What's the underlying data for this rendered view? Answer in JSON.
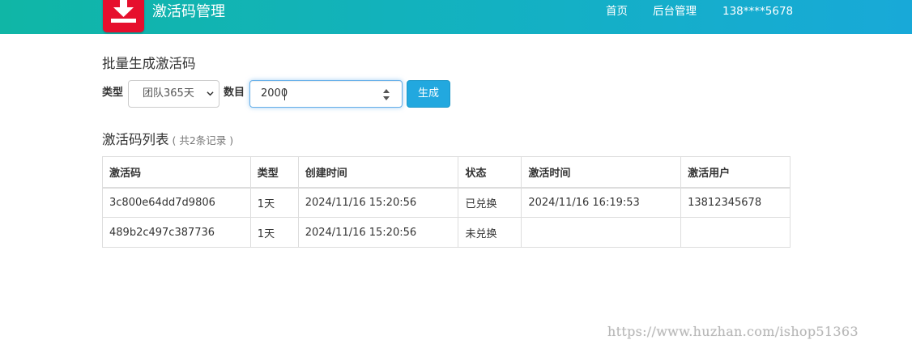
{
  "header": {
    "brand": "激活码管理",
    "logo_icon": "download-icon",
    "nav": {
      "home": "首页",
      "admin": "后台管理",
      "user": "138****5678"
    },
    "colors": {
      "gradient_start": "#10b6a6",
      "gradient_end": "#18a9d8",
      "logo_bg": "#e60f2d"
    }
  },
  "generate": {
    "title": "批量生成激活码",
    "type_label": "类型",
    "type_selected": "团队365天",
    "count_label": "数目",
    "count_value": "2000",
    "button_label": "生成",
    "button_color": "#22a8df"
  },
  "list": {
    "title": "激活码列表",
    "count_text": "( 共2条记录 )",
    "columns": [
      "激活码",
      "类型",
      "创建时间",
      "状态",
      "激活时间",
      "激活用户"
    ],
    "rows": [
      [
        "3c800e64dd7d9806",
        "1天",
        "2024/11/16 15:20:56",
        "已兑换",
        "2024/11/16 16:19:53",
        "13812345678"
      ],
      [
        "489b2c497c387736",
        "1天",
        "2024/11/16 15:20:56",
        "未兑换",
        "",
        ""
      ]
    ]
  },
  "watermark": "https://www.huzhan.com/ishop51363"
}
